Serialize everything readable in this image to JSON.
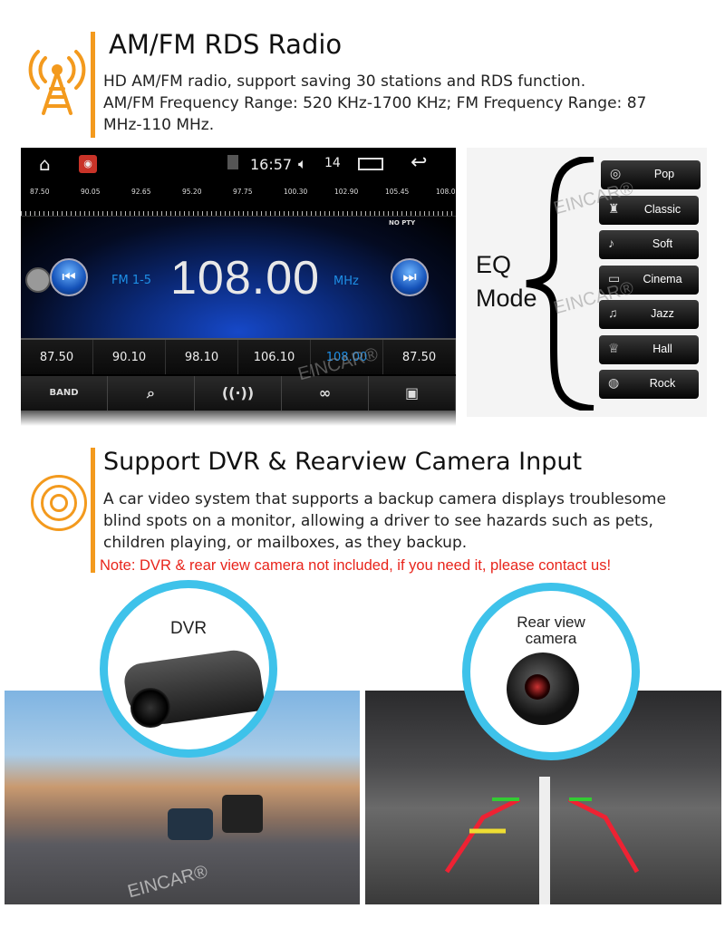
{
  "radio_section": {
    "title": "AM/FM RDS Radio",
    "desc_lines": [
      "HD AM/FM radio, support saving 30 stations and RDS function.",
      "AM/FM Frequency Range: 520 KHz-1700 KHz;  FM Frequency Range: 87",
      "MHz-110 MHz."
    ],
    "icon": "radio-tower-icon"
  },
  "radio_screen": {
    "time": "16:57",
    "volume": "14",
    "scale": [
      "87.50",
      "90.05",
      "92.65",
      "95.20",
      "97.75",
      "100.30",
      "102.90",
      "105.45",
      "108.00"
    ],
    "pty": "NO PTY",
    "band": "FM 1-5",
    "frequency": "108.00",
    "unit": "MHz",
    "presets": [
      "87.50",
      "90.10",
      "98.10",
      "106.10",
      "108.00",
      "87.50"
    ],
    "active_preset": "108.00",
    "band_button": "BAND",
    "accent": "#1e8fe6"
  },
  "eq": {
    "label_line1": "EQ",
    "label_line2": "Mode",
    "modes": [
      "Pop",
      "Classic",
      "Soft",
      "Cinema",
      "Jazz",
      "Hall",
      "Rock"
    ]
  },
  "camera_section": {
    "title": "Support DVR & Rearview Camera Input",
    "desc_lines": [
      "A car video system that supports a backup camera displays troublesome",
      "blind spots on a monitor, allowing a driver to see hazards such as pets,",
      "children playing, or mailboxes, as they backup."
    ],
    "note": "Note: DVR & rear view camera not included, if you need it, please contact us!",
    "icon": "camera-lens-icon"
  },
  "dvr_label": "DVR",
  "rear_label_line1": "Rear view",
  "rear_label_line2": "camera",
  "watermark": "EINCAR®",
  "colors": {
    "orange": "#f39a1e",
    "cyan": "#3ec2ea",
    "note_red": "#e8241b"
  }
}
